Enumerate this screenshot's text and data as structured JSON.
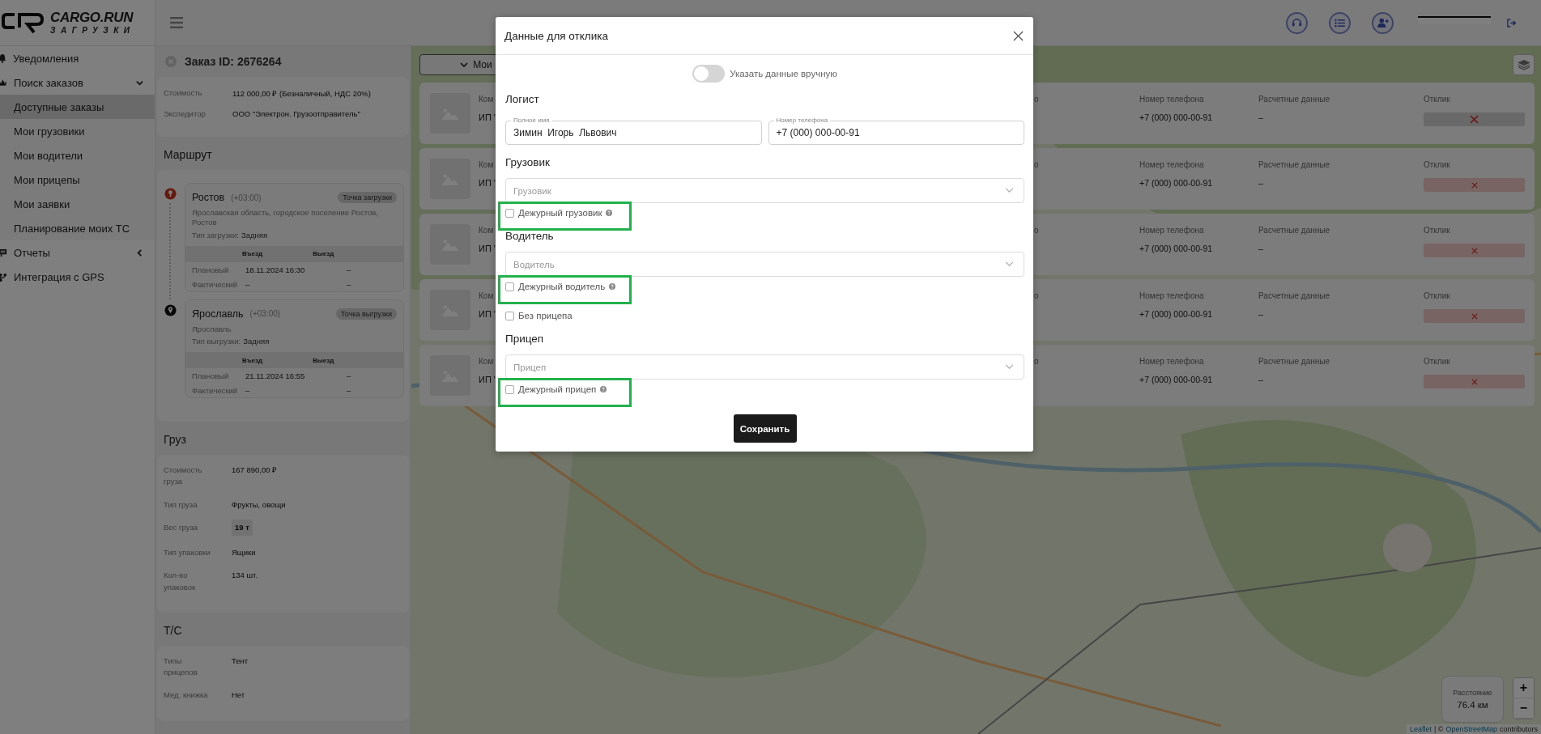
{
  "header": {
    "logo_title": "CARGO.RUN",
    "logo_subtitle": "ЗАГРУЗКИ"
  },
  "sidebar": {
    "items": [
      {
        "label": "Уведомления",
        "selected": false
      },
      {
        "label": "Поиск заказов",
        "selected": false,
        "expanded": true,
        "children": [
          {
            "label": "Доступные заказы",
            "selected": true
          },
          {
            "label": "Мои грузовики",
            "selected": false
          },
          {
            "label": "Мои водители",
            "selected": false
          },
          {
            "label": "Мои прицепы",
            "selected": false
          },
          {
            "label": "Мои заявки",
            "selected": false
          },
          {
            "label": "Планирование моих ТС",
            "selected": false
          }
        ]
      },
      {
        "label": "Отчеты",
        "selected": false,
        "expanded": false
      },
      {
        "label": "Интеграция с GPS",
        "selected": false
      }
    ]
  },
  "order": {
    "title": "Заказ ID: 2676264",
    "summary": [
      {
        "label": "Стоимость",
        "value": "112 000,00 ₽ (Безналичный, НДС 20%)"
      },
      {
        "label": "Экспедитор",
        "value": "ООО \"Электрон. Грузоотправитель\""
      }
    ],
    "route": {
      "heading": "Маршрут",
      "points": [
        {
          "kind": "loading",
          "city": "Ростов",
          "tz": "(+03:00)",
          "badge": "Точка загрузки",
          "address": "Ярославская область, городское поселение Ростов, Ростов",
          "type_label": "Тип загрузки:",
          "type_value": "Задняя",
          "columns": [
            "Въезд",
            "Выезд"
          ],
          "rows": [
            {
              "label": "Плановый",
              "in": "18.11.2024 16:30",
              "out": "–"
            },
            {
              "label": "Фактический",
              "in": "–",
              "out": "–"
            }
          ]
        },
        {
          "kind": "unloading",
          "city": "Ярославль",
          "tz": "(+03:00)",
          "badge": "Точка выгрузки",
          "address": "Ярославль",
          "type_label": "Тип выгрузки:",
          "type_value": "Задняя",
          "columns": [
            "Въезд",
            "Выезд"
          ],
          "rows": [
            {
              "label": "Плановый",
              "in": "21.11.2024 16:55",
              "out": "–"
            },
            {
              "label": "Фактический",
              "in": "–",
              "out": "–"
            }
          ]
        }
      ]
    },
    "cargo": {
      "heading": "Груз",
      "rows": [
        {
          "kind": "plain",
          "label": "Стоимость груза",
          "value": "167 890,00 ₽"
        },
        {
          "kind": "plain",
          "label": "Тип груза",
          "value": "Фрукты, овощи"
        },
        {
          "kind": "badge",
          "label": "Вес груза",
          "value": "19 т"
        },
        {
          "kind": "plain",
          "label": "Тип упаковки",
          "value": "Ящики"
        },
        {
          "kind": "plain",
          "label": "Кол-во упаковок",
          "value": "134 шт."
        }
      ]
    },
    "vehicle": {
      "heading": "Т/С",
      "rows": [
        {
          "kind": "plain",
          "label": "Типы прицепов",
          "value": "Тент"
        },
        {
          "kind": "plain",
          "label": "Мед. книжка",
          "value": "Нет"
        }
      ]
    }
  },
  "map": {
    "filter_button": "Мои",
    "responses": [
      {
        "company_label": "Ком",
        "company": "ИП \"",
        "column_3": "о",
        "phone_label": "Номер телефона",
        "phone": "+7 (000) 000-00-91",
        "payment_label": "Расчетные данные",
        "payment": "–",
        "response_label": "Отклик",
        "hovered": true
      },
      {
        "company_label": "Ком",
        "company": "ИП \"",
        "column_3": "о",
        "phone_label": "Номер телефона",
        "phone": "+7 (000) 000-00-91",
        "payment_label": "Расчетные данные",
        "payment": "–",
        "response_label": "Отклик",
        "hovered": false
      },
      {
        "company_label": "Ком",
        "company": "ИП \"",
        "column_3": "о",
        "phone_label": "Номер телефона",
        "phone": "+7 (000) 000-00-91",
        "payment_label": "Расчетные данные",
        "payment": "–",
        "response_label": "Отклик",
        "hovered": false
      },
      {
        "company_label": "Ком",
        "company": "ИП \"",
        "column_3": "о",
        "phone_label": "Номер телефона",
        "phone": "+7 (000) 000-00-91",
        "payment_label": "Расчетные данные",
        "payment": "–",
        "response_label": "Отклик",
        "hovered": false
      },
      {
        "company_label": "Ком",
        "company": "ИП \"",
        "column_3": "о",
        "phone_label": "Номер телефона",
        "phone": "+7 (000) 000-00-91",
        "payment_label": "Расчетные данные",
        "payment": "–",
        "response_label": "Отклик",
        "hovered": false
      }
    ],
    "distance": {
      "label": "Расстояние",
      "value": "76.4 км"
    },
    "zoom": [
      "+",
      "−"
    ],
    "attribution": {
      "link_1": "Leaflet",
      "separator": "| ©",
      "link_2": "OpenStreetMap",
      "rest": "contributors"
    }
  },
  "modal": {
    "title": "Данные для отклика",
    "manual_toggle": {
      "label": "Указать данные вручную",
      "on": false
    },
    "sections": [
      {
        "kind": "fields",
        "heading": "Логист",
        "fields": [
          {
            "label": "Полное имя",
            "value": "Зимин  Игорь  Львович"
          },
          {
            "label": "Номер телефона",
            "value": "+7 (000) 000-00-91"
          }
        ]
      },
      {
        "kind": "select",
        "heading": "Грузовик",
        "placeholder": "Грузовик",
        "checkboxes": [
          {
            "label": "Дежурный грузовик",
            "checked": false,
            "help": true,
            "highlighted": true
          }
        ]
      },
      {
        "kind": "select",
        "heading": "Водитель",
        "placeholder": "Водитель",
        "checkboxes": [
          {
            "label": "Дежурный водитель",
            "checked": false,
            "help": true,
            "highlighted": true
          },
          {
            "label": "Без прицепа",
            "checked": false,
            "help": false,
            "highlighted": false
          }
        ]
      },
      {
        "kind": "select",
        "heading": "Прицеп",
        "placeholder": "Прицеп",
        "checkboxes": [
          {
            "label": "Дежурный прицеп",
            "checked": false,
            "help": true,
            "highlighted": true
          }
        ]
      }
    ],
    "save_button": "Сохранить"
  }
}
